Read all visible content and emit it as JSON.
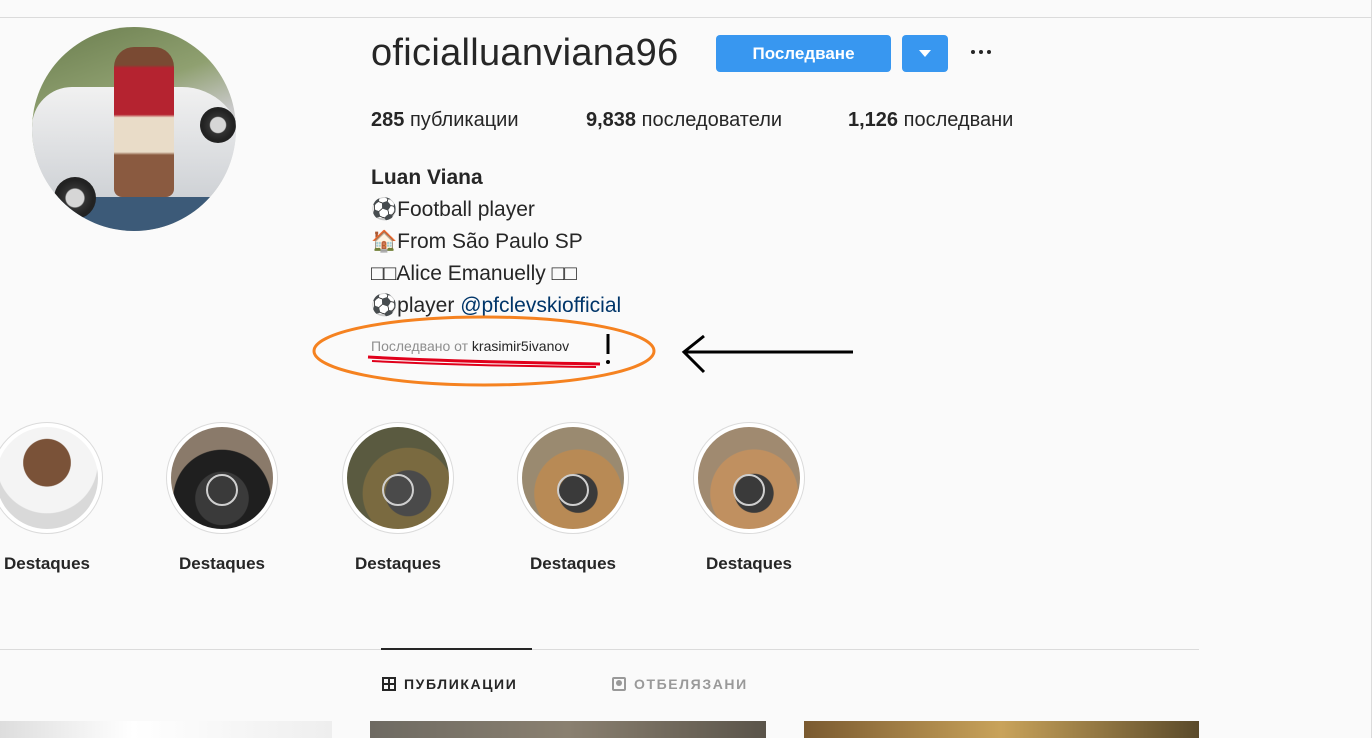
{
  "profile": {
    "username": "oficialluanviana96",
    "follow_label": "Последване",
    "stats": {
      "posts_count": "285",
      "posts_label": "публикации",
      "followers_count": "9,838",
      "followers_label": "последователи",
      "following_count": "1,126",
      "following_label": "последвани"
    },
    "bio": {
      "name": "Luan Viana",
      "line1": "⚽Football player",
      "line2": "🏠From São Paulo SP",
      "line3": "□□Alice Emanuelly □□",
      "line4_prefix": "⚽player ",
      "line4_mention": "@pfclevskiofficial"
    },
    "followed_by_prefix": "Последвано от ",
    "followed_by_user": "krasimir5ivanov"
  },
  "highlights": [
    {
      "label": "Destaques"
    },
    {
      "label": "Destaques"
    },
    {
      "label": "Destaques"
    },
    {
      "label": "Destaques"
    },
    {
      "label": "Destaques"
    }
  ],
  "tabs": {
    "posts": "ПУБЛИКАЦИИ",
    "tagged": "ОТБЕЛЯЗАНИ"
  },
  "colors": {
    "accent": "#3897f0",
    "annotation_ellipse": "#f58220",
    "annotation_underline": "#e0001b",
    "annotation_arrow": "#000000"
  }
}
